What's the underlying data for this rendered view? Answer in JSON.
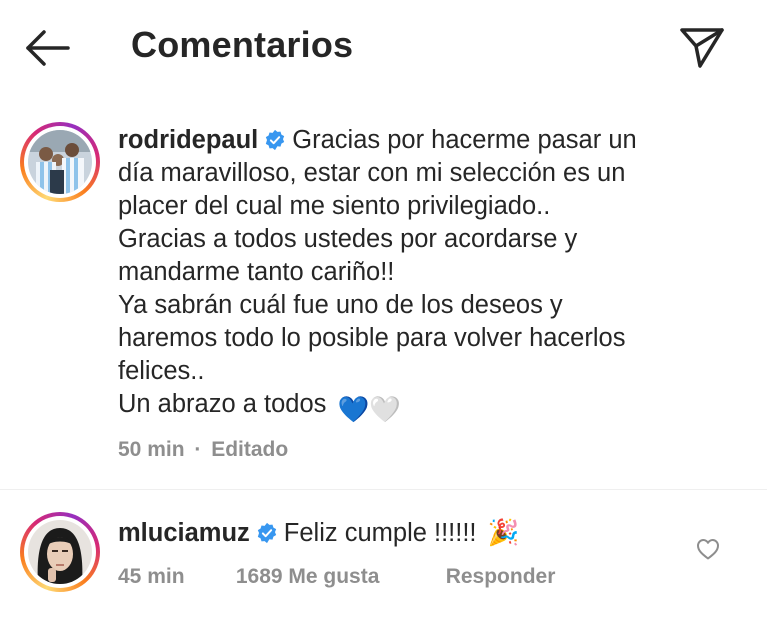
{
  "header": {
    "title": "Comentarios",
    "back_icon": "arrow-left-icon",
    "send_icon": "paper-plane-icon"
  },
  "caption": {
    "username": "rodridepaul",
    "verified": true,
    "lines": [
      "Gracias por hacerme pasar un",
      "día maravilloso, estar con mi selección es un",
      "placer del cual me siento privilegiado..",
      "Gracias a todos ustedes por acordarse y",
      "mandarme tanto cariño!!",
      "Ya sabrán cuál fue uno de los deseos y",
      "haremos todo lo posible para volver hacerlos",
      "felices..",
      "Un abrazo a todos"
    ],
    "emoji": "💙🤍",
    "time": "50 min",
    "separator": "·",
    "edited": "Editado"
  },
  "comments": [
    {
      "username": "mluciamuz",
      "verified": true,
      "text": "Feliz cumple !!!!!!",
      "emoji": "🎉",
      "time": "45 min",
      "likes": "1689 Me gusta",
      "reply": "Responder",
      "like_icon": "heart-outline-icon"
    }
  ],
  "colors": {
    "text": "#262626",
    "secondary": "#8e8e8e",
    "verified_blue": "#3897f0",
    "ring_start": "#feda75",
    "ring_mid": "#d62976",
    "ring_end": "#962fbf"
  }
}
